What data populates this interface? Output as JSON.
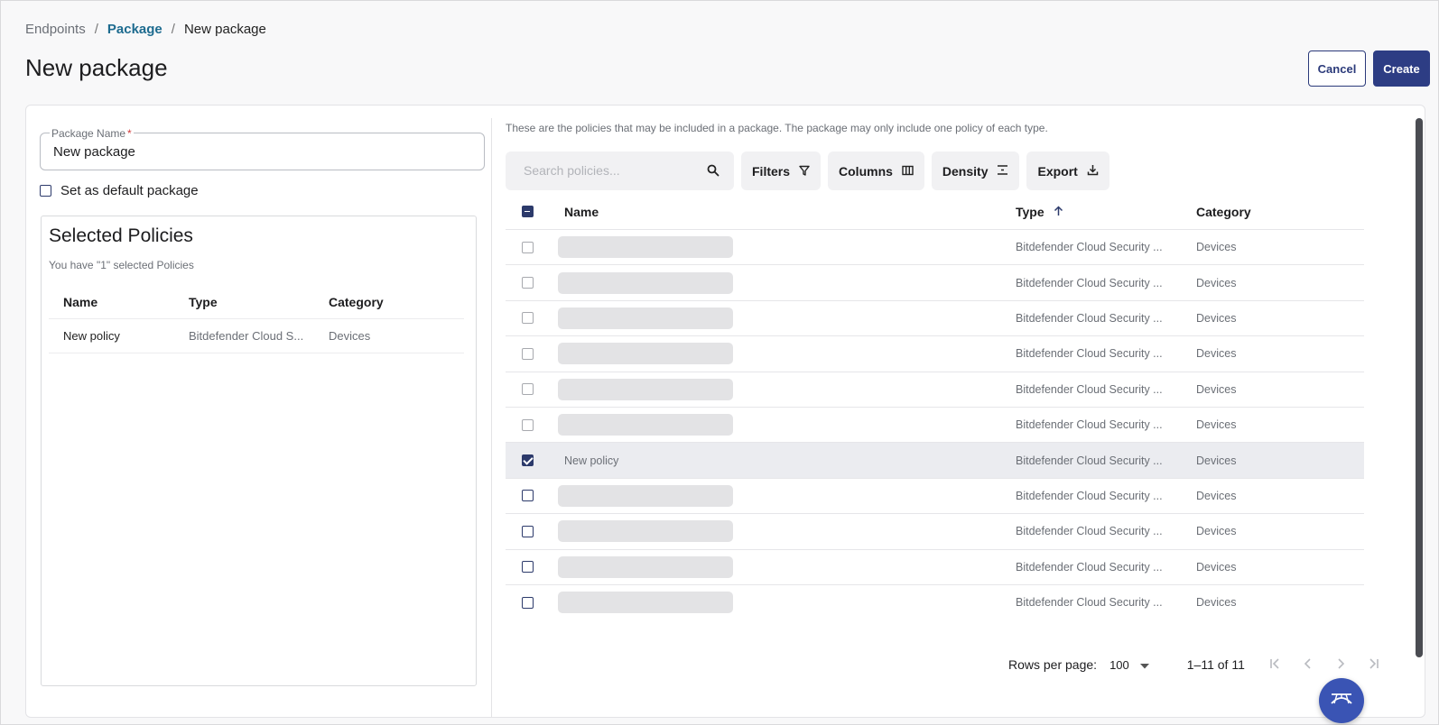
{
  "breadcrumb": {
    "root": "Endpoints",
    "parent": "Package",
    "current": "New package"
  },
  "page_title": "New package",
  "actions": {
    "cancel": "Cancel",
    "create": "Create"
  },
  "form": {
    "package_name_label": "Package Name",
    "required_mark": "*",
    "package_name_value": "New package",
    "default_checkbox_label": "Set as default package",
    "default_checked": false
  },
  "selected": {
    "title": "Selected Policies",
    "subtitle": "You have \"1\" selected Policies",
    "columns": {
      "name": "Name",
      "type": "Type",
      "category": "Category"
    },
    "rows": [
      {
        "name": "New policy",
        "type": "Bitdefender Cloud S...",
        "category": "Devices"
      }
    ]
  },
  "policies": {
    "description": "These are the policies that may be included in a package. The package may only include one policy of each type.",
    "search_placeholder": "Search policies...",
    "toolbar": {
      "filters": "Filters",
      "columns": "Columns",
      "density": "Density",
      "export": "Export"
    },
    "columns": {
      "name": "Name",
      "type": "Type",
      "category": "Category"
    },
    "rows": [
      {
        "name": "",
        "type": "Bitdefender Cloud Security ...",
        "category": "Devices",
        "checked": false,
        "loading": true
      },
      {
        "name": "",
        "type": "Bitdefender Cloud Security ...",
        "category": "Devices",
        "checked": false,
        "loading": true
      },
      {
        "name": "",
        "type": "Bitdefender Cloud Security ...",
        "category": "Devices",
        "checked": false,
        "loading": true
      },
      {
        "name": "",
        "type": "Bitdefender Cloud Security ...",
        "category": "Devices",
        "checked": false,
        "loading": true
      },
      {
        "name": "",
        "type": "Bitdefender Cloud Security ...",
        "category": "Devices",
        "checked": false,
        "loading": true
      },
      {
        "name": "",
        "type": "Bitdefender Cloud Security ...",
        "category": "Devices",
        "checked": false,
        "loading": true
      },
      {
        "name": "New policy",
        "type": "Bitdefender Cloud Security ...",
        "category": "Devices",
        "checked": true,
        "loading": false
      },
      {
        "name": "",
        "type": "Bitdefender Cloud Security ...",
        "category": "Devices",
        "checked": false,
        "loading": true
      },
      {
        "name": "",
        "type": "Bitdefender Cloud Security ...",
        "category": "Devices",
        "checked": false,
        "loading": true
      },
      {
        "name": "",
        "type": "Bitdefender Cloud Security ...",
        "category": "Devices",
        "checked": false,
        "loading": true
      },
      {
        "name": "",
        "type": "Bitdefender Cloud Security ...",
        "category": "Devices",
        "checked": false,
        "loading": true
      }
    ],
    "footer": {
      "rows_per_page_label": "Rows per page:",
      "rows_per_page": "100",
      "range": "1–11 of 11"
    }
  },
  "colors": {
    "primary": "#2d3d84",
    "link": "#1d6b8f",
    "fab": "#3a54b4"
  }
}
